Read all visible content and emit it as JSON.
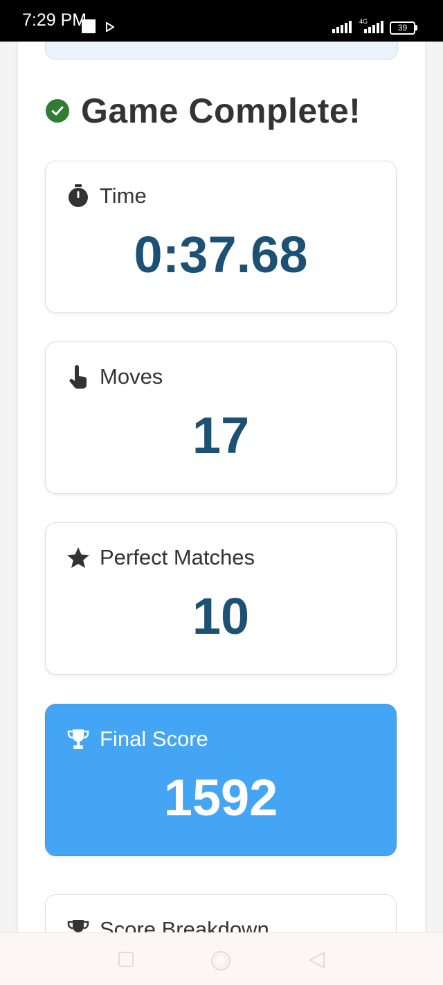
{
  "status_bar": {
    "time": "7:29 PM",
    "network": "4G",
    "battery": "39"
  },
  "result": {
    "heading": "Game Complete!"
  },
  "stats": {
    "time": {
      "label": "Time",
      "value": "0:37.68",
      "icon": "stopwatch-icon"
    },
    "moves": {
      "label": "Moves",
      "value": "17",
      "icon": "tap-hand-icon"
    },
    "perfect_matches": {
      "label": "Perfect Matches",
      "value": "10",
      "icon": "star-icon"
    },
    "final_score": {
      "label": "Final Score",
      "value": "1592",
      "icon": "trophy-icon"
    }
  },
  "breakdown": {
    "label": "Score Breakdown",
    "icon": "trophy-icon"
  },
  "colors": {
    "value_text": "#1d5174",
    "highlight_card": "#45a5f5",
    "check": "#2e7d32"
  }
}
